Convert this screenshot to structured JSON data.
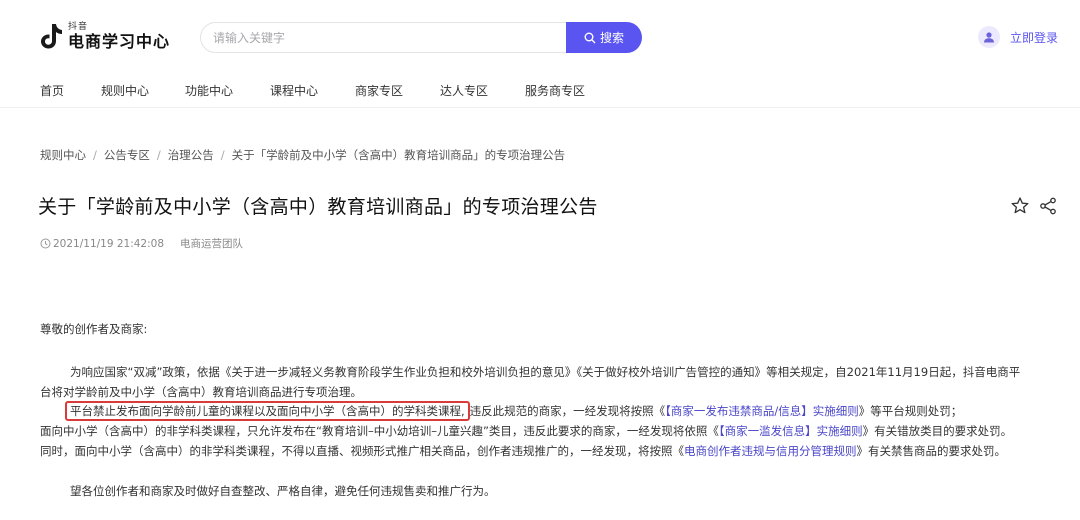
{
  "header": {
    "logo_small": "抖音",
    "logo_main": "电商学习中心",
    "search_placeholder": "请输入关键字",
    "search_button": "搜索",
    "login_label": "立即登录"
  },
  "nav": {
    "items": [
      "首页",
      "规则中心",
      "功能中心",
      "课程中心",
      "商家专区",
      "达人专区",
      "服务商专区"
    ]
  },
  "breadcrumb": {
    "items": [
      "规则中心",
      "公告专区",
      "治理公告",
      "关于「学龄前及中小学（含高中）教育培训商品」的专项治理公告"
    ]
  },
  "article": {
    "title": "关于「学龄前及中小学（含高中）教育培训商品」的专项治理公告",
    "date": "2021/11/19 21:42:08",
    "author": "电商运营团队",
    "greeting": "尊敬的创作者及商家:",
    "p1_line1": "为响应国家“双减”政策，依据《关于进一步减轻义务教育阶段学生作业负担和校外培训负担的意见》《关于做好校外培训广告管控的通知》等相关规定，自2021年11月19日起，抖音电商平",
    "p1_line2": "台将对学龄前及中小学（含高中）教育培训商品进行专项治理。",
    "p2_highlight": "平台禁止发布面向学龄前儿童的课程以及面向中小学（含高中）的学科类课程,",
    "p2_rest_a": "违反此规范的商家，一经发现将按照《",
    "p2_link": "【商家一发布违禁商品/信息】实施细则",
    "p2_rest_b": "》等平台规则处罚；",
    "p3_a": "面向中小学（含高中）的非学科类课程，只允许发布在“教育培训–中小幼培训–儿童兴趣”类目，违反此要求的商家，一经发现将依照《",
    "p3_link": "【商家一滥发信息】实施细则",
    "p3_b": "》有关错放类目的要求处罚。",
    "p4_a": "同时，面向中小学（含高中）的非学科类课程，不得以直播、视频形式推广相关商品，创作者违规推广的，一经发现，将按照《",
    "p4_link": "电商创作者违规与信用分管理规则",
    "p4_b": "》有关禁售商品的要求处罚。",
    "p5": "望各位创作者和商家及时做好自查整改、严格自律，避免任何违规售卖和推广行为。"
  },
  "colors": {
    "accent": "#5a55f0",
    "link": "#4a46c8",
    "highlight_border": "#d93a3a"
  }
}
